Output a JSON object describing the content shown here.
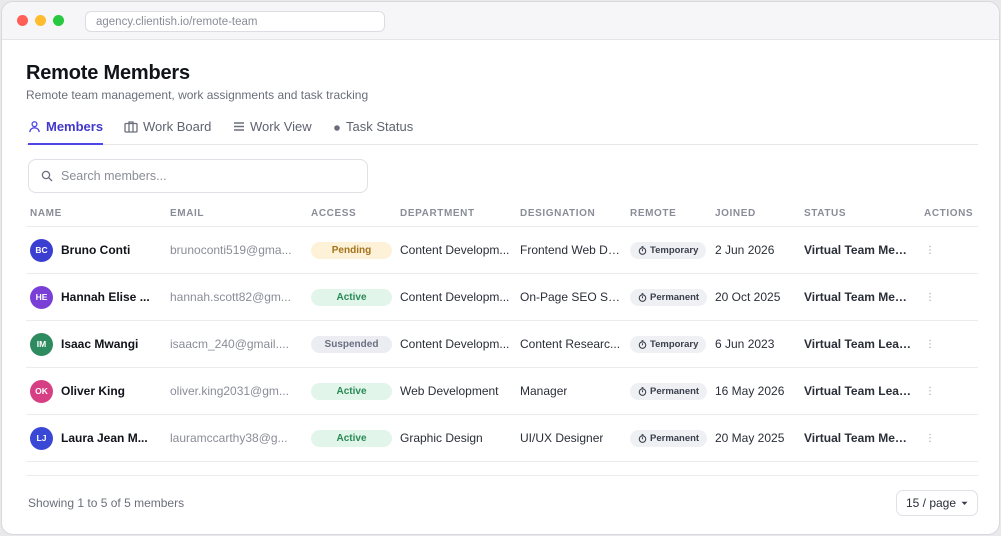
{
  "browser": {
    "url": "agency.clientish.io/remote-team"
  },
  "page": {
    "title": "Remote Members",
    "subtitle": "Remote team management, work assignments and task tracking"
  },
  "tabs": [
    {
      "label": "Members",
      "icon": "user-icon",
      "active": true
    },
    {
      "label": "Work Board",
      "icon": "briefcase-icon",
      "active": false
    },
    {
      "label": "Work View",
      "icon": "list-icon",
      "active": false
    },
    {
      "label": "Task Status",
      "icon": "dot-icon",
      "active": false
    }
  ],
  "search": {
    "placeholder": "Search members...",
    "value": ""
  },
  "table": {
    "columns": [
      "NAME",
      "EMAIL",
      "ACCESS",
      "DEPARTMENT",
      "DESIGNATION",
      "REMOTE",
      "JOINED",
      "STATUS",
      "ACTIONS"
    ],
    "rows": [
      {
        "initials": "BC",
        "avatar_color": "#3b3fd1",
        "name": "Bruno Conti",
        "email": "brunoconti519@gma...",
        "access": "Pending",
        "access_kind": "pending",
        "department": "Content Developm...",
        "designation": "Frontend Web De...",
        "remote": "Temporary",
        "joined": "2 Jun 2026",
        "status": "Virtual Team Mem..."
      },
      {
        "initials": "HE",
        "avatar_color": "#7a3fd6",
        "name": "Hannah Elise ...",
        "email": "hannah.scott82@gm...",
        "access": "Active",
        "access_kind": "active",
        "department": "Content Developm...",
        "designation": "On-Page SEO Sp...",
        "remote": "Permanent",
        "joined": "20 Oct 2025",
        "status": "Virtual Team Mem..."
      },
      {
        "initials": "IM",
        "avatar_color": "#2e8b5f",
        "name": "Isaac Mwangi",
        "email": "isaacm_240@gmail....",
        "access": "Suspended",
        "access_kind": "suspended",
        "department": "Content Developm...",
        "designation": "Content Researc...",
        "remote": "Temporary",
        "joined": "6 Jun 2023",
        "status": "Virtual Team Leader"
      },
      {
        "initials": "OK",
        "avatar_color": "#d63f84",
        "name": "Oliver King",
        "email": "oliver.king2031@gm...",
        "access": "Active",
        "access_kind": "active",
        "department": "Web Development",
        "designation": "Manager",
        "remote": "Permanent",
        "joined": "16 May 2026",
        "status": "Virtual Team Leader"
      },
      {
        "initials": "LJ",
        "avatar_color": "#3a48d6",
        "name": "Laura Jean M...",
        "email": "lauramccarthy38@g...",
        "access": "Active",
        "access_kind": "active",
        "department": "Graphic Design",
        "designation": "UI/UX Designer",
        "remote": "Permanent",
        "joined": "20 May 2025",
        "status": "Virtual Team Mem..."
      }
    ]
  },
  "footer": {
    "summary": "Showing 1 to 5 of 5 members",
    "page_size": "15 / page"
  }
}
